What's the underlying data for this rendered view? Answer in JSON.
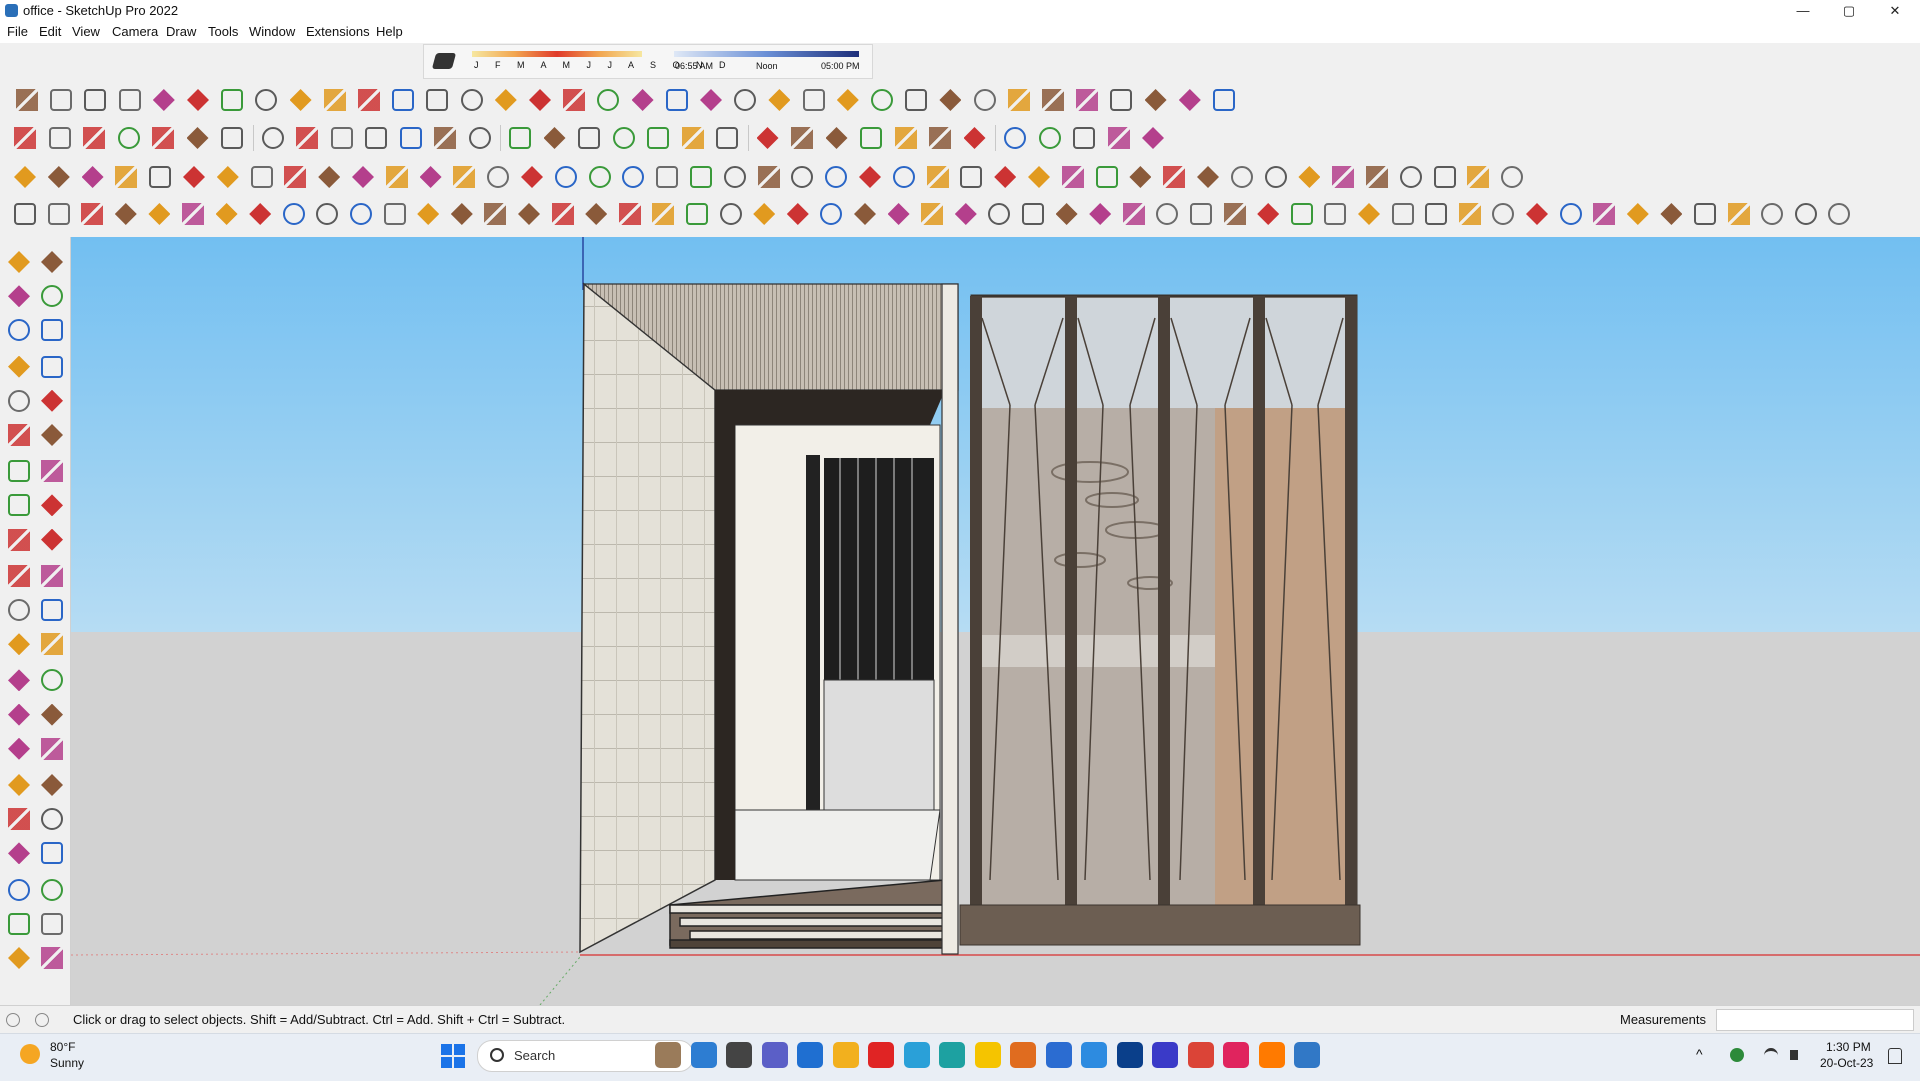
{
  "window": {
    "title": "office - SketchUp Pro 2022",
    "minimize": "—",
    "maximize": "▢",
    "close": "✕"
  },
  "menu": [
    "File",
    "Edit",
    "View",
    "Camera",
    "Draw",
    "Tools",
    "Window",
    "Extensions",
    "Help"
  ],
  "shadow_bar": {
    "months": "J F M A M J J A S O N D",
    "time_start": "06:55 AM",
    "time_mid": "Noon",
    "time_end": "05:00 PM"
  },
  "status": {
    "hint": "Click or drag to select objects. Shift = Add/Subtract. Ctrl = Add. Shift + Ctrl = Subtract.",
    "measurements_label": "Measurements",
    "measurements_value": ""
  },
  "taskbar": {
    "weather_temp": "80°F",
    "weather_desc": "Sunny",
    "search_placeholder": "Search",
    "time": "1:30 PM",
    "date": "20-Oct-23"
  },
  "colors": {
    "sky": "#7fc6f3",
    "ground": "#d2d2d2",
    "accent": "#0f6cbd"
  },
  "icons": {
    "toolbar_row1": [
      "freehand-icon",
      "bezier-icon",
      "paint-icon",
      "scissors-icon",
      "circle-icon",
      "lasso-icon",
      "curve-icon",
      "sphere-icon",
      "spiral-icon",
      "arc-icon",
      "fillet-icon",
      "line-icon",
      "chamfer-icon",
      "pipe-icon",
      "cone-icon",
      "columns-icon",
      "grid-icon",
      "hand-icon",
      "loft-icon",
      "bend-icon",
      "stairs-icon",
      "roof-icon",
      "wall-icon",
      "beam-icon",
      "window-icon",
      "door-icon",
      "frame-icon",
      "railing-icon",
      "truss-icon",
      "terrain-icon",
      "ribbon-icon",
      "tower-icon",
      "box-icon",
      "house-icon",
      "barn-icon",
      "shed-icon"
    ],
    "toolbar_row2": [
      "zoom-icon",
      "select-icon",
      "eraser-icon",
      "pencil-icon",
      "arc-tool-icon",
      "rectangle-icon",
      "push-pull-icon",
      "offset-icon",
      "move-icon",
      "rotate-icon",
      "scale-icon",
      "tape-icon",
      "text-icon",
      "paint-bucket-icon",
      "orbit-icon",
      "pan-icon",
      "zoom-window-icon",
      "zoom-extents-icon",
      "component-icon",
      "layer-icon",
      "section-icon",
      "style-icon",
      "shadow-icon",
      "fog-icon",
      "sandbox-icon",
      "vray-render-icon",
      "vray-light-icon",
      "vray-sphere-icon",
      "vray-dome-icon",
      "vray-ies-icon",
      "vray-mesh-icon",
      "vray-settings-icon",
      "vray-frame-icon"
    ],
    "toolbar_row3": [
      "camera-icon",
      "box3d-icon",
      "cube-icon",
      "grass-icon",
      "texture-icon",
      "array-icon",
      "copy-icon",
      "flip-icon",
      "tree-icon",
      "door2-icon",
      "flag-icon",
      "ruler-icon",
      "shapes-icon",
      "circle2-icon",
      "polygon-icon",
      "ellipse-icon",
      "plane-icon",
      "arc2-icon",
      "spiral2-icon",
      "polygon2-icon",
      "pen-icon",
      "wand-icon",
      "mirror-icon",
      "cutter-icon",
      "cross-icon",
      "intersect-icon",
      "outline-icon",
      "solid-icon",
      "sphere2-icon",
      "cone2-icon",
      "drum-icon",
      "clock-icon",
      "measure-icon",
      "print-icon",
      "frame2-icon",
      "window2-icon",
      "photo-icon",
      "lock-icon",
      "sofa-icon",
      "brick-icon",
      "material-icon",
      "terrain2-icon",
      "stone-icon",
      "roof2-icon",
      "scene-icon"
    ],
    "toolbar_row4": [
      "solid-tools-icon",
      "trophy-icon",
      "target-icon",
      "compass-icon",
      "protractor-icon",
      "sun-icon",
      "dome-icon",
      "sphere3-icon",
      "union-icon",
      "subtract-icon",
      "pattern-icon",
      "iso-view-icon",
      "front-view-icon",
      "back-view-icon",
      "hidden-icon",
      "cube-select-icon",
      "blue-diamond-icon",
      "blue-diamond2-icon",
      "yellow-diamond-icon",
      "green-diamond-icon",
      "red-diamond-icon",
      "gray-diamond-icon",
      "loop-icon",
      "red-box-icon",
      "stack-icon",
      "panel-icon",
      "wood-icon",
      "tape2-icon",
      "curve2-icon",
      "dotted-curve-icon",
      "red-cross-icon",
      "green-cross-icon",
      "blue-cross-icon",
      "pyramid-icon",
      "house-graph-icon",
      "triangle-icon",
      "ring-icon",
      "ring2-icon",
      "ring3-icon",
      "axes-icon",
      "paint2-icon",
      "magnet-icon",
      "tree2-icon",
      "cube2-icon",
      "cube3-icon",
      "cube4-icon",
      "gem-icon",
      "cubes-icon",
      "frame3-icon",
      "grid2-icon",
      "grid3-icon",
      "grid4-icon",
      "red-x-icon",
      "arc3-icon",
      "network-icon"
    ],
    "left_toolbar": [
      "select-icon",
      "orbit-icon",
      "paint-bucket-icon",
      "eraser-icon",
      "component-icon",
      "pencil-icon",
      "line-icon",
      "freehand-icon",
      "rectangle-icon",
      "rotated-rectangle-icon",
      "circle-icon",
      "polygon-icon",
      "arc-icon",
      "pie-icon",
      "two-point-arc-icon",
      "three-point-arc-icon",
      "move-icon",
      "push-pull-icon",
      "rotate-icon",
      "follow-me-icon",
      "scale-icon",
      "offset-icon",
      "tape-icon",
      "dimension-icon",
      "protractor-icon",
      "text-icon",
      "axes-icon",
      "3d-text-icon",
      "orbit2-icon",
      "pan-icon",
      "zoom-icon",
      "zoom-window-icon",
      "zoom-extents-icon",
      "previous-icon",
      "walk-icon",
      "look-icon",
      "footprint-icon",
      "position-icon",
      "section-plane-icon",
      "section-fill-icon",
      "layers-icon",
      "layers2-icon"
    ]
  }
}
